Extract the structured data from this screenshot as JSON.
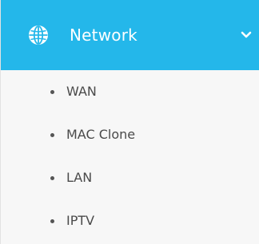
{
  "menu": {
    "header": {
      "label": "Network",
      "icon": "globe-icon",
      "expand_icon": "chevron-down-icon",
      "background_color": "#24b7ea",
      "text_color": "#ffffff"
    },
    "items": [
      {
        "label": "WAN"
      },
      {
        "label": "MAC Clone"
      },
      {
        "label": "LAN"
      },
      {
        "label": "IPTV"
      }
    ]
  }
}
